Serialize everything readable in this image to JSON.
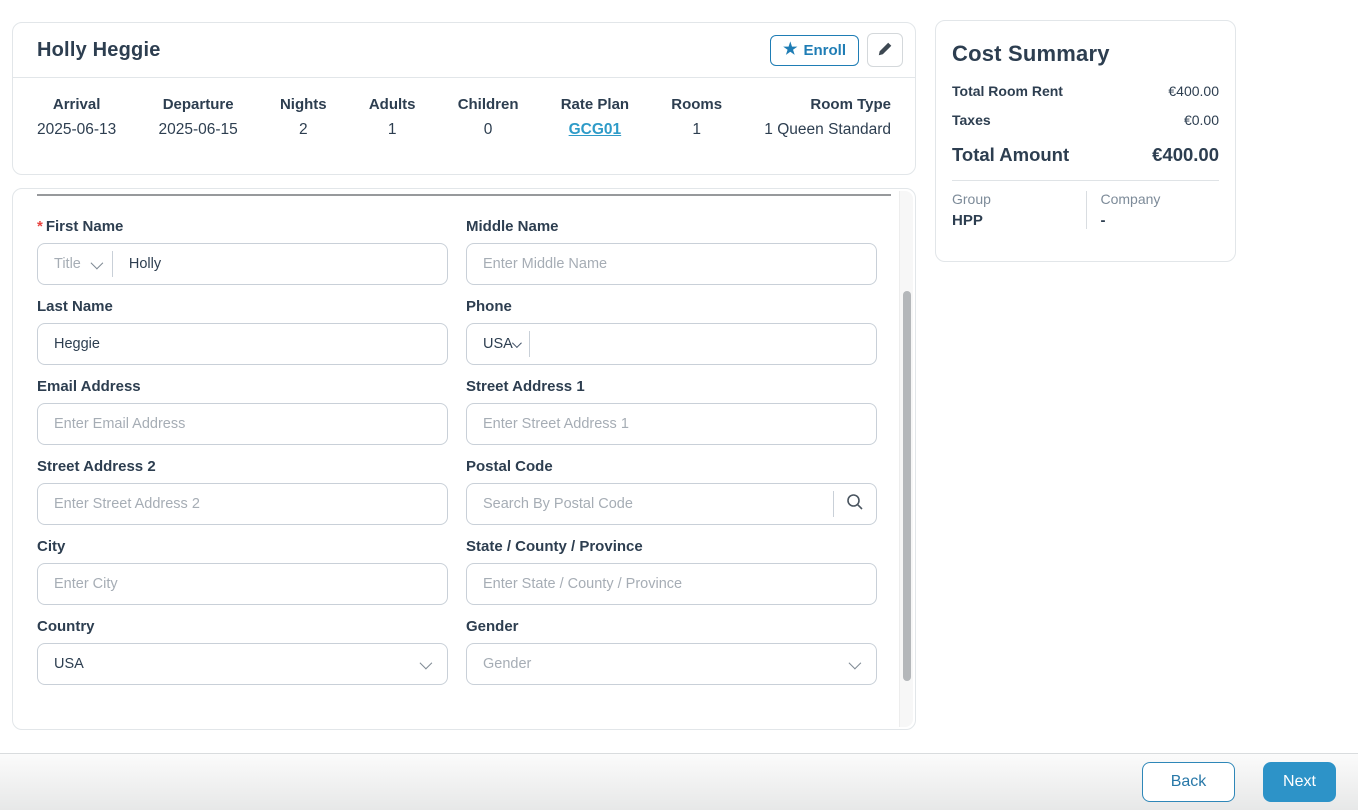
{
  "guest": {
    "name": "Holly Heggie",
    "enroll_label": "Enroll",
    "summary": {
      "columns": [
        {
          "label": "Arrival",
          "value": "2025-06-13"
        },
        {
          "label": "Departure",
          "value": "2025-06-15"
        },
        {
          "label": "Nights",
          "value": "2"
        },
        {
          "label": "Adults",
          "value": "1"
        },
        {
          "label": "Children",
          "value": "0"
        },
        {
          "label": "Rate Plan",
          "value": "GCG01"
        },
        {
          "label": "Rooms",
          "value": "1"
        },
        {
          "label": "Room Type",
          "value": "1 Queen Standard"
        }
      ]
    }
  },
  "form": {
    "required_mark": "*",
    "first_name": {
      "label": "First Name",
      "title_placeholder": "Title",
      "value": "Holly"
    },
    "middle_name": {
      "label": "Middle Name",
      "placeholder": "Enter Middle Name"
    },
    "last_name": {
      "label": "Last Name",
      "value": "Heggie"
    },
    "phone": {
      "label": "Phone",
      "country_code": "USA"
    },
    "email": {
      "label": "Email Address",
      "placeholder": "Enter Email Address"
    },
    "street1": {
      "label": "Street Address 1",
      "placeholder": "Enter Street Address 1"
    },
    "street2": {
      "label": "Street Address 2",
      "placeholder": "Enter Street Address 2"
    },
    "postal": {
      "label": "Postal Code",
      "placeholder": "Search By Postal Code"
    },
    "city": {
      "label": "City",
      "placeholder": "Enter City"
    },
    "state": {
      "label": "State / County / Province",
      "placeholder": "Enter State / County / Province"
    },
    "country": {
      "label": "Country",
      "value": "USA"
    },
    "gender": {
      "label": "Gender",
      "placeholder": "Gender"
    }
  },
  "cost_summary": {
    "title": "Cost Summary",
    "rows": [
      {
        "label": "Total Room Rent",
        "value": "€400.00"
      },
      {
        "label": "Taxes",
        "value": "€0.00"
      }
    ],
    "total": {
      "label": "Total Amount",
      "value": "€400.00"
    },
    "group": {
      "label": "Group",
      "value": "HPP"
    },
    "company": {
      "label": "Company",
      "value": "-"
    }
  },
  "footer": {
    "back_label": "Back",
    "next_label": "Next"
  },
  "icons": {
    "star": "★"
  },
  "colors": {
    "accent": "#1f7db5",
    "link": "#2e9bc8",
    "next_bg": "#2d93c8",
    "required": "#e8423e",
    "text": "#2d3e50",
    "placeholder": "#a6adb5"
  }
}
